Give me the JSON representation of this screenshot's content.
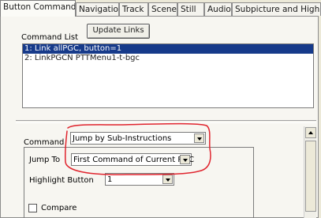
{
  "tabs": [
    {
      "label": "Button Commands",
      "active": true
    },
    {
      "label": "Navigation"
    },
    {
      "label": "Track"
    },
    {
      "label": "Scene"
    },
    {
      "label": "Still"
    },
    {
      "label": "Audio"
    },
    {
      "label": "Subpicture and Highlight"
    }
  ],
  "command_list": {
    "label": "Command List",
    "update_button": "Update Links",
    "items": [
      {
        "text": "1: Link allPGC, button=1",
        "selected": true
      },
      {
        "text": "2: LinkPGCN PTTMenu1-t-bgc",
        "selected": false
      }
    ]
  },
  "command": {
    "label": "Command",
    "value": "Jump by Sub-Instructions"
  },
  "jump_to": {
    "label": "Jump To",
    "value": "First Command of Current PGC"
  },
  "highlight_button": {
    "label": "Highlight Button",
    "value": "1"
  },
  "compare": {
    "label": "Compare",
    "checked": false
  },
  "colors": {
    "selection": "#163a8a",
    "annotation": "#e0242e"
  }
}
